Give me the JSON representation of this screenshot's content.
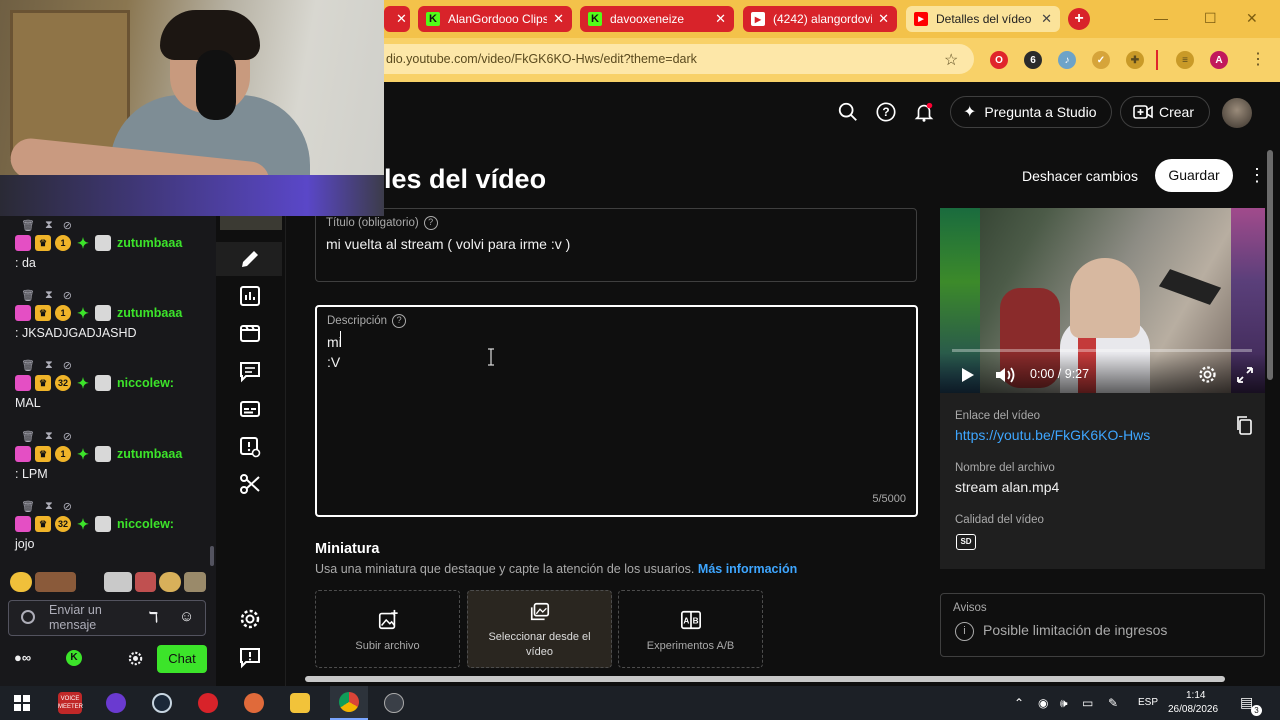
{
  "browser": {
    "tabs": [
      {
        "label": "AlanGordooo Clips",
        "favicon": "kick-icon"
      },
      {
        "label": "davooxeneize",
        "favicon": "kick-icon"
      },
      {
        "label": "(4242) alangordovi",
        "favicon": "youtube-icon"
      },
      {
        "label": "Detalles del vídeo",
        "favicon": "youtube-studio-icon"
      }
    ],
    "url": "dio.youtube.com/video/FkGK6KO-Hws/edit?theme=dark",
    "profile_initial": "A",
    "extension_badge": "6"
  },
  "studio_header": {
    "ask_studio_label": "Pregunta a Studio",
    "create_label": "Crear"
  },
  "page": {
    "title": "les del vídeo",
    "undo_label": "Deshacer cambios",
    "save_label": "Guardar"
  },
  "form": {
    "title_label": "Título (obligatorio)",
    "title_value": "mi vuelta al stream ( volvi para irme :v )",
    "description_label": "Descripción",
    "description_lines": [
      "mi",
      ":V"
    ],
    "description_counter": "5/5000",
    "thumbnail_title": "Miniatura",
    "thumbnail_subtitle": "Usa una miniatura que destaque y capte la atención de los usuarios.",
    "thumbnail_more": "Más información",
    "thumb_options": [
      {
        "label": "Subir archivo",
        "icon": "add-image-icon"
      },
      {
        "label": "Seleccionar desde el vídeo",
        "icon": "image-stack-icon"
      },
      {
        "label": "Experimentos A/B",
        "icon": "ab-test-icon"
      }
    ]
  },
  "video_panel": {
    "time": "0:00 / 9:27",
    "link_label": "Enlace del vídeo",
    "link_value": "https://youtu.be/FkGK6KO-Hws",
    "file_label": "Nombre del archivo",
    "file_value": "stream alan.mp4",
    "quality_label": "Calidad del vídeo",
    "quality_badge": "SD",
    "warnings_label": "Avisos",
    "warning_value": "Posible limitación de ingresos"
  },
  "chat": {
    "messages": [
      {
        "user": "zutumbaaa",
        "text": ": da",
        "user_color": "#3ce42a",
        "badge": "1"
      },
      {
        "user": "zutumbaaa",
        "text": ": JKSADJGADJASHD",
        "user_color": "#3ce42a",
        "badge": "1"
      },
      {
        "user": "niccolew:",
        "text": "MAL",
        "user_color": "#3ce42a",
        "badge": "32"
      },
      {
        "user": "zutumbaaa",
        "text": ": LPM",
        "user_color": "#3ce42a",
        "badge": "1"
      },
      {
        "user": "niccolew:",
        "text": "jojo",
        "user_color": "#3ce42a",
        "badge": "32"
      }
    ],
    "input_placeholder": "Enviar un mensaje",
    "chat_button": "Chat"
  },
  "taskbar": {
    "lang": "ESP",
    "time": "1:14",
    "date": "26/08/2026",
    "notifications": "3",
    "voicemeeter_label": "VOICE MEETER"
  },
  "colors": {
    "tabbar": "#f3c24a",
    "link": "#3ea6ff",
    "chat_accent": "#3ce42a"
  }
}
